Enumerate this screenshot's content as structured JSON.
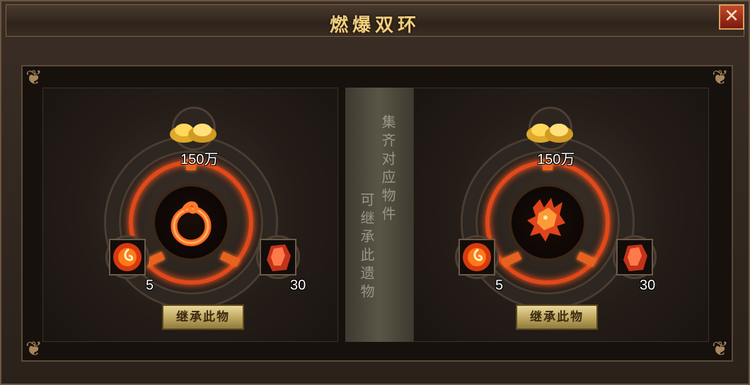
{
  "window": {
    "title": "燃爆双环",
    "close_glyph": "✕"
  },
  "divider": {
    "line1": "集齐对应物件",
    "line2": "可继承此遗物"
  },
  "panels": [
    {
      "gold": "150万",
      "left_count": "5",
      "right_count": "30",
      "button": "继承此物",
      "center_icon": "fire-ring-icon"
    },
    {
      "gold": "150万",
      "left_count": "5",
      "right_count": "30",
      "button": "继承此物",
      "center_icon": "fire-dragon-icon"
    }
  ],
  "colors": {
    "fire": "#e2481a",
    "title_gold": "#f1cf7e",
    "button_gold": "#d8c47e"
  }
}
